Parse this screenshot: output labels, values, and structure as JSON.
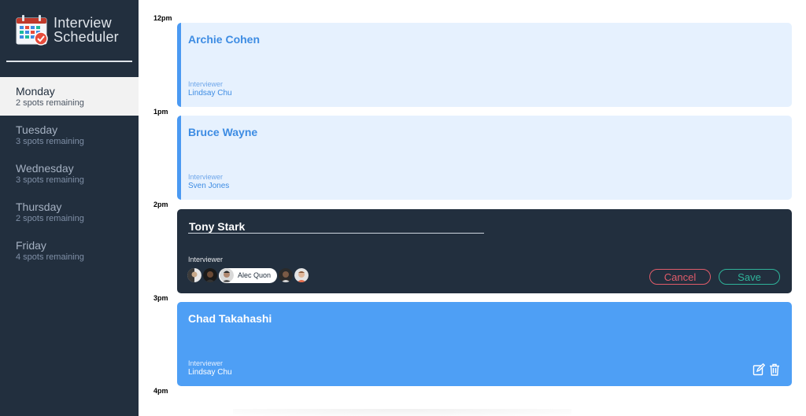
{
  "brand": {
    "title_line1": "Interview",
    "title_line2": "Scheduler",
    "logo_icon": "calendar-check-icon",
    "colors": {
      "sidebar_bg": "#222f3e",
      "accent": "#4a99f2",
      "danger": "#e05c6a",
      "success": "#2fb39a"
    }
  },
  "days": [
    {
      "name": "Monday",
      "spots": "2 spots remaining"
    },
    {
      "name": "Tuesday",
      "spots": "3 spots remaining"
    },
    {
      "name": "Wednesday",
      "spots": "3 spots remaining"
    },
    {
      "name": "Thursday",
      "spots": "2 spots remaining"
    },
    {
      "name": "Friday",
      "spots": "4 spots remaining"
    }
  ],
  "selected_day": "Monday",
  "schedule": {
    "times": [
      "12pm",
      "1pm",
      "2pm",
      "3pm",
      "4pm"
    ],
    "appointments": [
      {
        "student": "Archie Cohen",
        "interviewer_label": "Interviewer",
        "interviewer": "Lindsay Chu",
        "mode": "show"
      },
      {
        "student": "Bruce Wayne",
        "interviewer_label": "Interviewer",
        "interviewer": "Sven Jones",
        "mode": "show"
      },
      {
        "student": "Tony Stark",
        "interviewer_label": "Interviewer",
        "mode": "edit",
        "selected_interviewer": "Alec Quon",
        "cancel_label": "Cancel",
        "save_label": "Save"
      },
      {
        "student": "Chad Takahashi",
        "interviewer_label": "Interviewer",
        "interviewer": "Lindsay Chu",
        "mode": "hover",
        "edit_icon": "edit-icon",
        "delete_icon": "trash-icon"
      }
    ]
  }
}
